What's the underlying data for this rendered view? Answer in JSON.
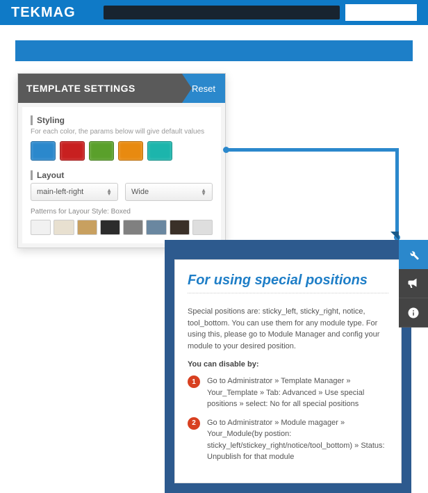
{
  "topbar": {
    "logo": "TEKMAG"
  },
  "settings": {
    "title": "TEMPLATE SETTINGS",
    "reset_label": "Reset",
    "styling_label": "Styling",
    "styling_desc": "For each color, the params below will give default values",
    "swatches": [
      "#2b88cc",
      "#c82020",
      "#5aa02b",
      "#e88a10",
      "#1cb5ac"
    ],
    "layout_label": "Layout",
    "select1": "main-left-right",
    "select2": "Wide",
    "patterns_label": "Patterns for Layour Style: Boxed",
    "patterns": [
      "#f1f1f1",
      "#e8e0d0",
      "#c8a060",
      "#2c2c2c",
      "#808080",
      "#6a87a0",
      "#3a3028",
      "#dedede"
    ]
  },
  "positions": {
    "title": "For using special positions",
    "intro": "Special positions are: sticky_left, sticky_right, notice, tool_bottom. You can use them for any module type. For using this, please go to Module Manager and config your module to your desired position.",
    "disable_label": "You can disable by:",
    "steps": [
      "Go to Administrator » Template Manager » Your_Template » Tab: Advanced » Use special positions » select: No for all special positions",
      "Go to Administrator » Module magager » Your_Module(by postion: sticky_left/stickey_right/notice/tool_bottom) » Status: Unpublish for that module"
    ]
  }
}
